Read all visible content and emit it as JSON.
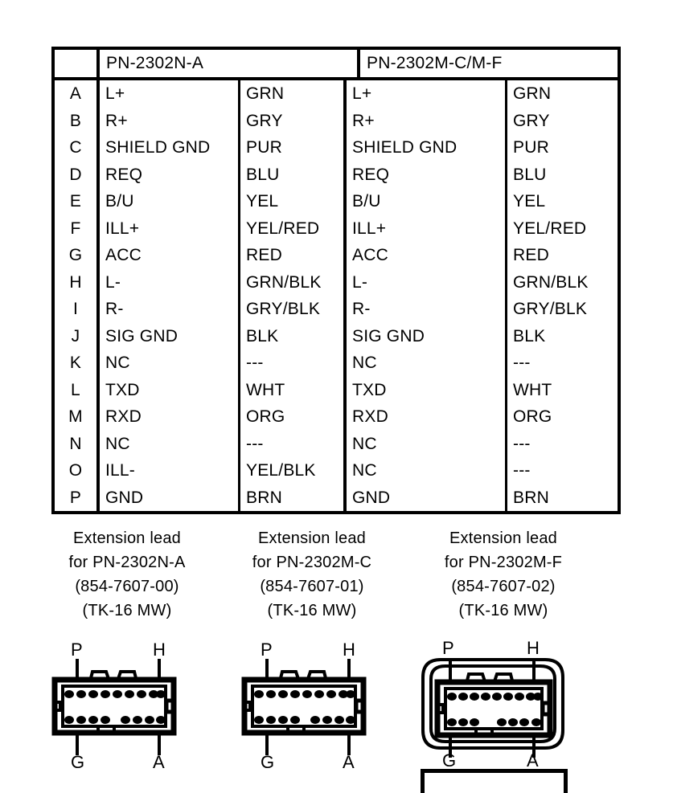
{
  "table": {
    "header": {
      "blank": "",
      "group_a": "PN-2302N-A",
      "group_b": "PN-2302M-C/M-F"
    },
    "rows": [
      {
        "letter": "A",
        "sig_a": "L+",
        "col_a": "GRN",
        "sig_b": "L+",
        "col_b": "GRN"
      },
      {
        "letter": "B",
        "sig_a": "R+",
        "col_a": "GRY",
        "sig_b": "R+",
        "col_b": "GRY"
      },
      {
        "letter": "C",
        "sig_a": "SHIELD GND",
        "col_a": "PUR",
        "sig_b": "SHIELD GND",
        "col_b": "PUR"
      },
      {
        "letter": "D",
        "sig_a": "REQ",
        "col_a": "BLU",
        "sig_b": "REQ",
        "col_b": "BLU"
      },
      {
        "letter": "E",
        "sig_a": "B/U",
        "col_a": "YEL",
        "sig_b": "B/U",
        "col_b": "YEL"
      },
      {
        "letter": "F",
        "sig_a": "ILL+",
        "col_a": "YEL/RED",
        "sig_b": "ILL+",
        "col_b": "YEL/RED"
      },
      {
        "letter": "G",
        "sig_a": "ACC",
        "col_a": "RED",
        "sig_b": "ACC",
        "col_b": "RED"
      },
      {
        "letter": "H",
        "sig_a": "L-",
        "col_a": "GRN/BLK",
        "sig_b": "L-",
        "col_b": "GRN/BLK"
      },
      {
        "letter": "I",
        "sig_a": "R-",
        "col_a": "GRY/BLK",
        "sig_b": "R-",
        "col_b": "GRY/BLK"
      },
      {
        "letter": "J",
        "sig_a": "SIG GND",
        "col_a": "BLK",
        "sig_b": "SIG GND",
        "col_b": "BLK"
      },
      {
        "letter": "K",
        "sig_a": "NC",
        "col_a": "---",
        "sig_b": "NC",
        "col_b": "---"
      },
      {
        "letter": "L",
        "sig_a": "TXD",
        "col_a": "WHT",
        "sig_b": "TXD",
        "col_b": "WHT"
      },
      {
        "letter": "M",
        "sig_a": "RXD",
        "col_a": "ORG",
        "sig_b": "RXD",
        "col_b": "ORG"
      },
      {
        "letter": "N",
        "sig_a": "NC",
        "col_a": "---",
        "sig_b": "NC",
        "col_b": "---"
      },
      {
        "letter": "O",
        "sig_a": "ILL-",
        "col_a": "YEL/BLK",
        "sig_b": "NC",
        "col_b": "---"
      },
      {
        "letter": "P",
        "sig_a": "GND",
        "col_a": "BRN",
        "sig_b": "GND",
        "col_b": "BRN"
      }
    ]
  },
  "captions": [
    {
      "line1": "Extension lead",
      "line2": "for PN-2302N-A",
      "line3": "(854-7607-00)",
      "line4": "(TK-16 MW)"
    },
    {
      "line1": "Extension lead",
      "line2": "for PN-2302M-C",
      "line3": "(854-7607-01)",
      "line4": "(TK-16 MW)"
    },
    {
      "line1": "Extension lead",
      "line2": "for PN-2302M-F",
      "line3": "(854-7607-02)",
      "line4": "(TK-16 MW)"
    }
  ],
  "connectors": [
    {
      "pin_top_left": "P",
      "pin_top_right": "H",
      "pin_bottom_left": "G",
      "pin_bottom_right": "A"
    },
    {
      "pin_top_left": "P",
      "pin_top_right": "H",
      "pin_bottom_left": "G",
      "pin_bottom_right": "A"
    },
    {
      "pin_top_left": "P",
      "pin_top_right": "H",
      "pin_bottom_left": "G",
      "pin_bottom_right": "A"
    }
  ],
  "colors": {
    "ink": "#000000",
    "paper": "#ffffff"
  }
}
